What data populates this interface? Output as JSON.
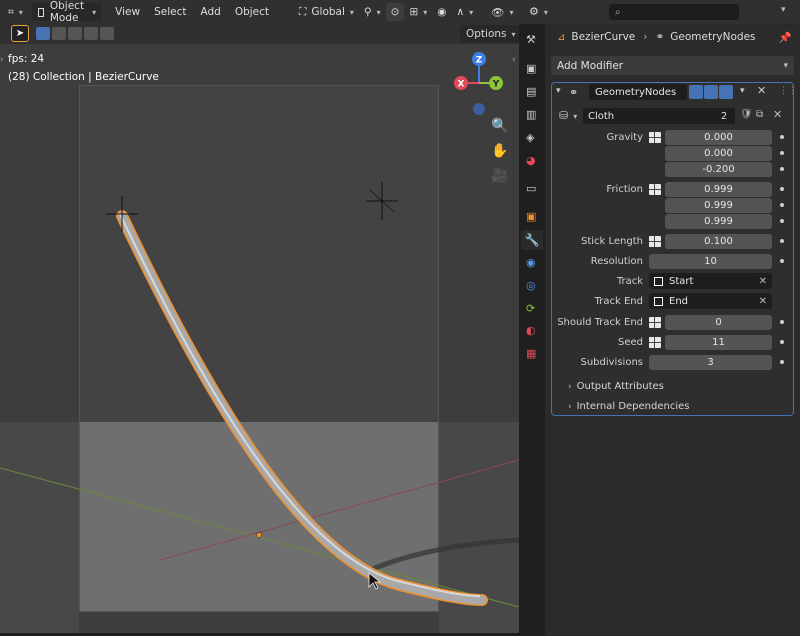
{
  "viewport": {
    "mode": "Object Mode",
    "menus": [
      "View",
      "Select",
      "Add",
      "Object"
    ],
    "orientation": "Global",
    "options_label": "Options",
    "fps_text": "fps: 24",
    "collection_text": "(28) Collection | BezierCurve",
    "gizmo": {
      "z": "Z",
      "y": "Y",
      "x": "X"
    }
  },
  "properties": {
    "breadcrumb_object": "BezierCurve",
    "breadcrumb_modifier": "GeometryNodes",
    "add_modifier": "Add Modifier",
    "modifier_name": "GeometryNodes",
    "node_group": "Cloth",
    "node_group_users": "2",
    "inputs": {
      "gravity_label": "Gravity",
      "gravity": [
        "0.000",
        "0.000",
        "-0.200"
      ],
      "friction_label": "Friction",
      "friction": [
        "0.999",
        "0.999",
        "0.999"
      ],
      "stick_length_label": "Stick Length",
      "stick_length": "0.100",
      "resolution_label": "Resolution",
      "resolution": "10",
      "track_label": "Track",
      "track": "Start",
      "track_end_label": "Track End",
      "track_end": "End",
      "should_track_end_label": "Should Track End",
      "should_track_end": "0",
      "seed_label": "Seed",
      "seed": "11",
      "subdivisions_label": "Subdivisions",
      "subdivisions": "3"
    },
    "output_attributes": "Output Attributes",
    "internal_dependencies": "Internal Dependencies"
  },
  "colors": {
    "accent": "#4772b3",
    "curve_outline": "#f0902a",
    "axis_x": "#e04a5a",
    "axis_y": "#8cc43a",
    "axis_z": "#3b7ee8"
  }
}
